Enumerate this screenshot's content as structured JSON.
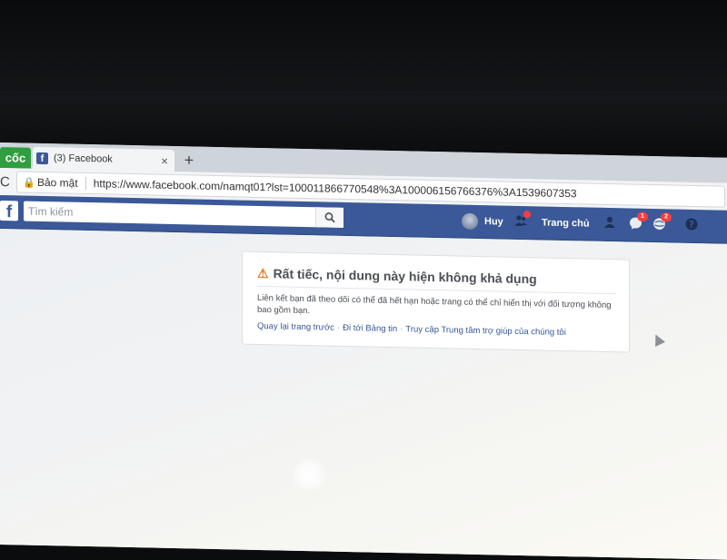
{
  "browser": {
    "coc_tab": "cốc",
    "tab_title": "(3) Facebook",
    "tab_close": "×",
    "new_tab": "+",
    "reload": "C",
    "secure_label": "Bảo mật",
    "url": "https://www.facebook.com/namqt01?lst=100011866770548%3A100006156766376%3A1539607353"
  },
  "facebook": {
    "logo": "f",
    "search_placeholder": "Tìm kiếm",
    "user_name": "Huy",
    "home_label": "Trang chủ",
    "messages_badge": "1",
    "notifications_badge": "2"
  },
  "error": {
    "title": "Rất tiếc, nội dung này hiện không khả dụng",
    "body": "Liên kết bạn đã theo dõi có thể đã hết hạn hoặc trang có thể chỉ hiển thị với đối tượng không bao gồm bạn.",
    "links": [
      "Quay lại trang trước",
      "Đi tới Bảng tin",
      "Truy cập Trung tâm trợ giúp của chúng tôi"
    ],
    "separator": "·"
  },
  "colors": {
    "facebook_blue": "#3b5998",
    "link": "#365899",
    "badge_red": "#fa3e3e",
    "coc_green": "#2f9e3f"
  },
  "icons": [
    "fb-favicon",
    "lock-icon",
    "search-icon",
    "avatar",
    "friends-icon",
    "friend-requests-icon",
    "messenger-icon",
    "notifications-icon",
    "help-icon",
    "warning-icon",
    "cursor-icon"
  ]
}
